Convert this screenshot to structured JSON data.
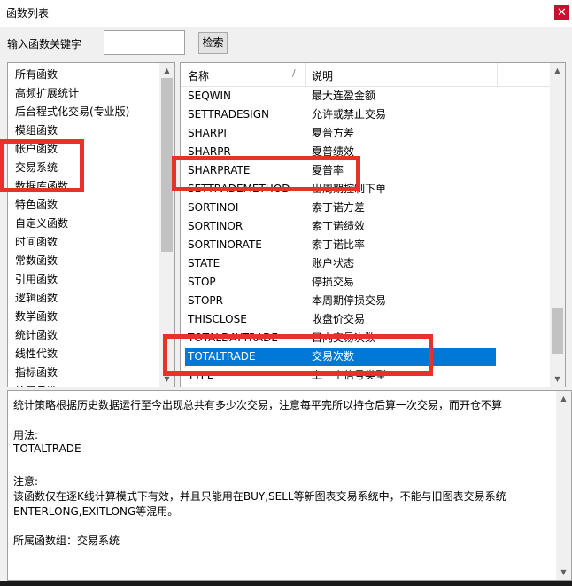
{
  "window": {
    "title": "函数列表",
    "close_glyph": "✕"
  },
  "search": {
    "label": "输入函数关键字",
    "value": "",
    "button_label": "检索"
  },
  "categories": [
    "所有函数",
    "高频扩展统计",
    "后台程式化交易(专业版)",
    "模组函数",
    "帐户函数",
    "交易系统",
    "数据库函数",
    "特色函数",
    "自定义函数",
    "时间函数",
    "常数函数",
    "引用函数",
    "逻辑函数",
    "数学函数",
    "统计函数",
    "线性代数",
    "指标函数",
    "绘图函数"
  ],
  "functions": {
    "headers": {
      "name": "名称",
      "sort_glyph": "/",
      "desc": "说明"
    },
    "rows": [
      {
        "name": "SEQWIN",
        "desc": "最大连盈金额"
      },
      {
        "name": "SETTRADESIGN",
        "desc": "允许或禁止交易"
      },
      {
        "name": "SHARPI",
        "desc": "夏普方差"
      },
      {
        "name": "SHARPR",
        "desc": "夏普绩效"
      },
      {
        "name": "SHARPRATE",
        "desc": "夏普率"
      },
      {
        "name": "SETTRADEMETHOD",
        "desc": "出周期控制下单"
      },
      {
        "name": "SORTINOI",
        "desc": "索丁诺方差"
      },
      {
        "name": "SORTINOR",
        "desc": "索丁诺绩效"
      },
      {
        "name": "SORTINORATE",
        "desc": "索丁诺比率"
      },
      {
        "name": "STATE",
        "desc": "账户状态"
      },
      {
        "name": "STOP",
        "desc": "停损交易"
      },
      {
        "name": "STOPR",
        "desc": "本周期停损交易"
      },
      {
        "name": "THISCLOSE",
        "desc": "收盘价交易"
      },
      {
        "name": "TOTALDAYTRADE",
        "desc": "日内交易次数"
      },
      {
        "name": "TOTALTRADE",
        "desc": "交易次数",
        "selected": true
      },
      {
        "name": "TYPE",
        "desc": "上一个信号类型"
      }
    ]
  },
  "description": {
    "lines": [
      "统计策略根据历史数据运行至今出现总共有多少次交易，注意每平完所以持仓后算一次交易，而开仓不算",
      "",
      "用法:",
      "TOTALTRADE",
      "",
      "注意:",
      "该函数仅在逐K线计算模式下有效，并且只能用在BUY,SELL等新图表交易系统中，不能与旧图表交易系统",
      "ENTERLONG,EXITLONG等混用。",
      "",
      "所属函数组：交易系统"
    ]
  },
  "colors": {
    "selection": "#0078d7",
    "highlight_box": "#e8312b"
  }
}
